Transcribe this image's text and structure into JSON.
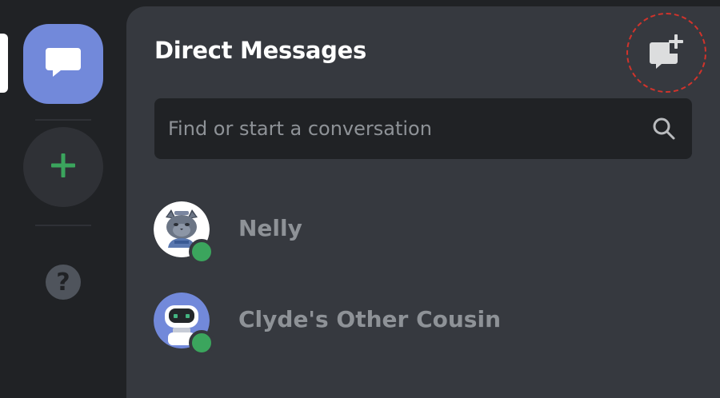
{
  "rail": {
    "home_icon": "chat-bubble-icon",
    "add_icon": "plus-icon",
    "help_label": "?",
    "accent_color": "#7289da",
    "add_color": "#3ba55d"
  },
  "panel": {
    "title": "Direct Messages",
    "new_dm_icon": "new-message-icon"
  },
  "search": {
    "placeholder": "Find or start a conversation",
    "icon": "search-icon"
  },
  "dms": [
    {
      "name": "Nelly",
      "status": "online",
      "avatar": "cat-avatar"
    },
    {
      "name": "Clyde's Other Cousin",
      "status": "online",
      "avatar": "robot-avatar"
    }
  ],
  "colors": {
    "online": "#3ba55d",
    "highlight_ring": "#d1332b"
  }
}
